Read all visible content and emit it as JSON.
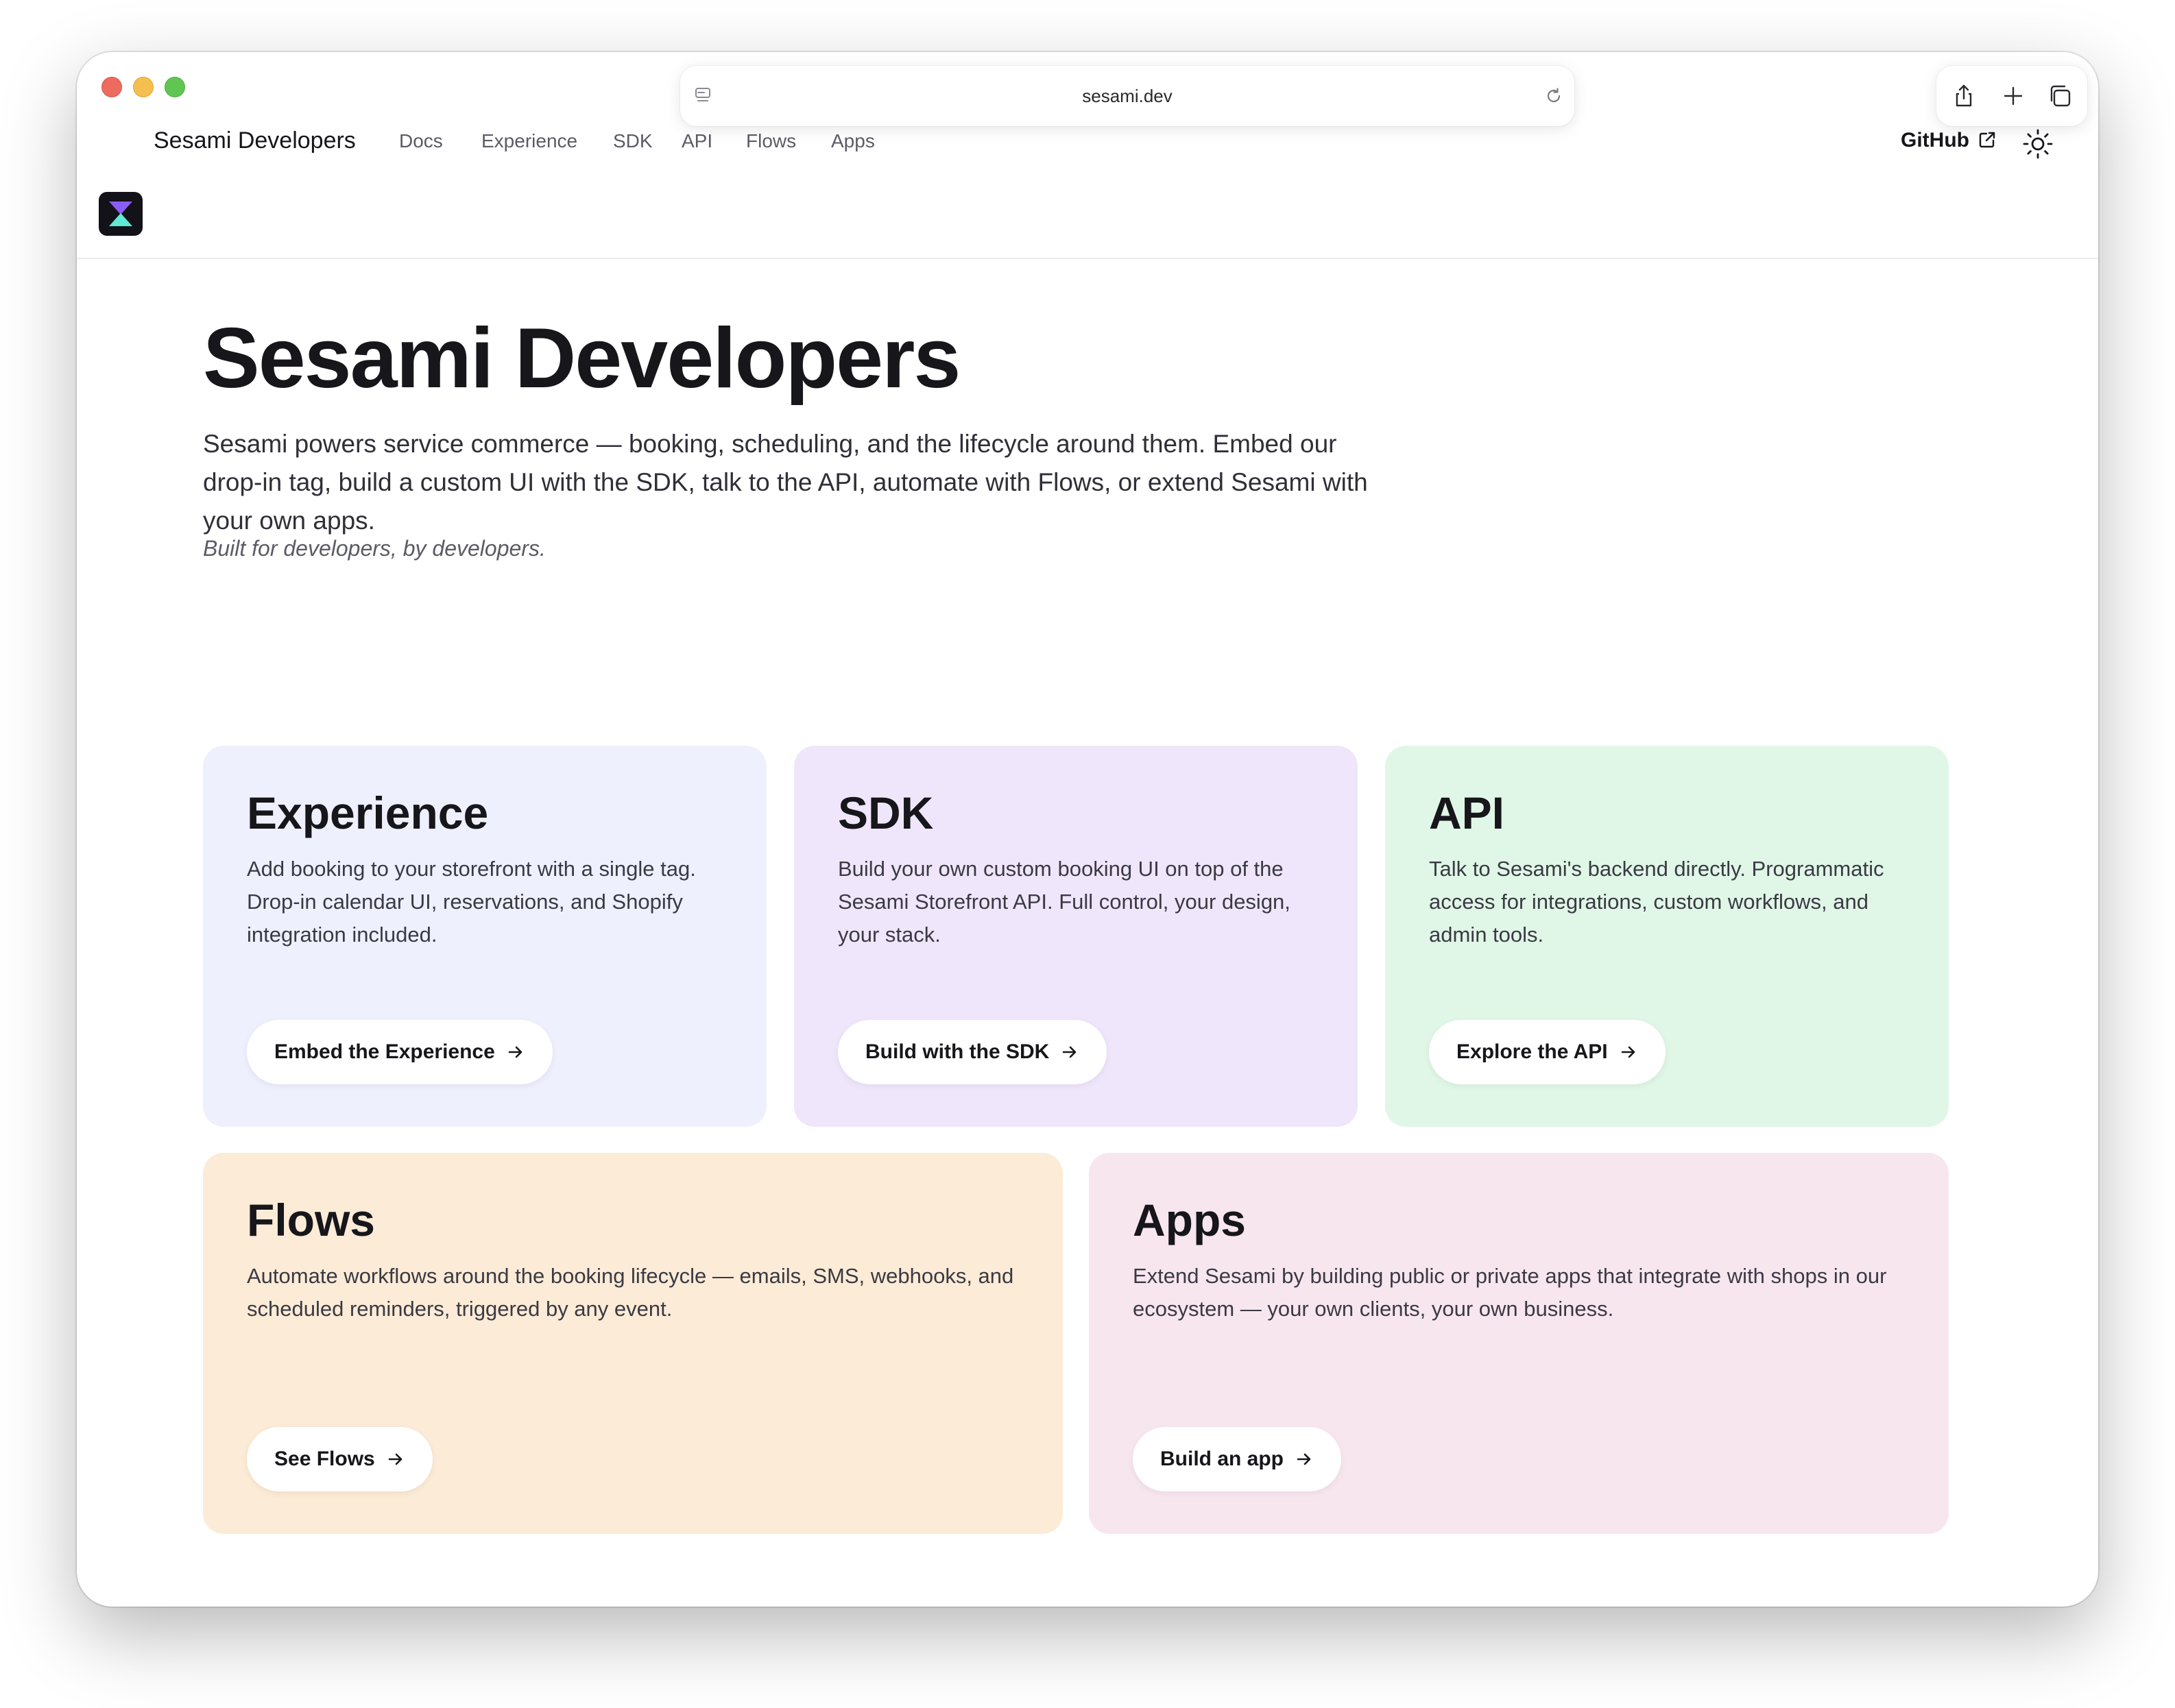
{
  "browser": {
    "url": "sesami.dev",
    "icons": [
      "site-settings-icon",
      "reload-icon",
      "share-icon",
      "new-tab-icon",
      "tab-overview-icon"
    ]
  },
  "header": {
    "brand": "Sesami Developers",
    "nav": [
      {
        "label": "Docs",
        "active": true
      },
      {
        "label": "Experience",
        "active": false
      },
      {
        "label": "SDK",
        "active": false
      },
      {
        "label": "API",
        "active": false
      },
      {
        "label": "Flows",
        "active": false
      },
      {
        "label": "Apps",
        "active": false
      }
    ],
    "github_label": "GitHub",
    "icons": [
      "sesami-logo-icon",
      "external-link-icon",
      "theme-toggle-icon"
    ]
  },
  "hero": {
    "title": "Sesami Developers",
    "description": "Sesami powers service commerce — booking, scheduling, and the lifecycle around them. Embed our drop-in tag, build a custom UI with the SDK, talk to the API, automate with Flows, or extend Sesami with your own apps.",
    "tagline": "Built for developers, by developers."
  },
  "cards": [
    {
      "title": "Experience",
      "description": "Add booking to your storefront with a single tag. Drop-in calendar UI, reservations, and Shopify integration included.",
      "button": "Embed the Experience",
      "color": "#eef0fd"
    },
    {
      "title": "SDK",
      "description": "Build your own custom booking UI on top of the Sesami Storefront API. Full control, your design, your stack.",
      "button": "Build with the SDK",
      "color": "#f0e6fb"
    },
    {
      "title": "API",
      "description": "Talk to Sesami's backend directly. Programmatic access for integrations, custom workflows, and admin tools.",
      "button": "Explore the API",
      "color": "#e0f7e7"
    },
    {
      "title": "Flows",
      "description": "Automate workflows around the booking lifecycle — emails, SMS, webhooks, and scheduled reminders, triggered by any event.",
      "button": "See Flows",
      "color": "#fcebd6"
    },
    {
      "title": "Apps",
      "description": "Extend Sesami by building public or private apps that integrate with shops in our ecosystem — your own clients, your own business.",
      "button": "Build an app",
      "color": "#f8e6ef"
    }
  ],
  "colors": {
    "text_primary": "#16161b",
    "text_secondary": "#5b5b66",
    "logo_bg": "#121218",
    "logo_top": "#8b5cf6",
    "logo_bottom": "#5eead4"
  }
}
